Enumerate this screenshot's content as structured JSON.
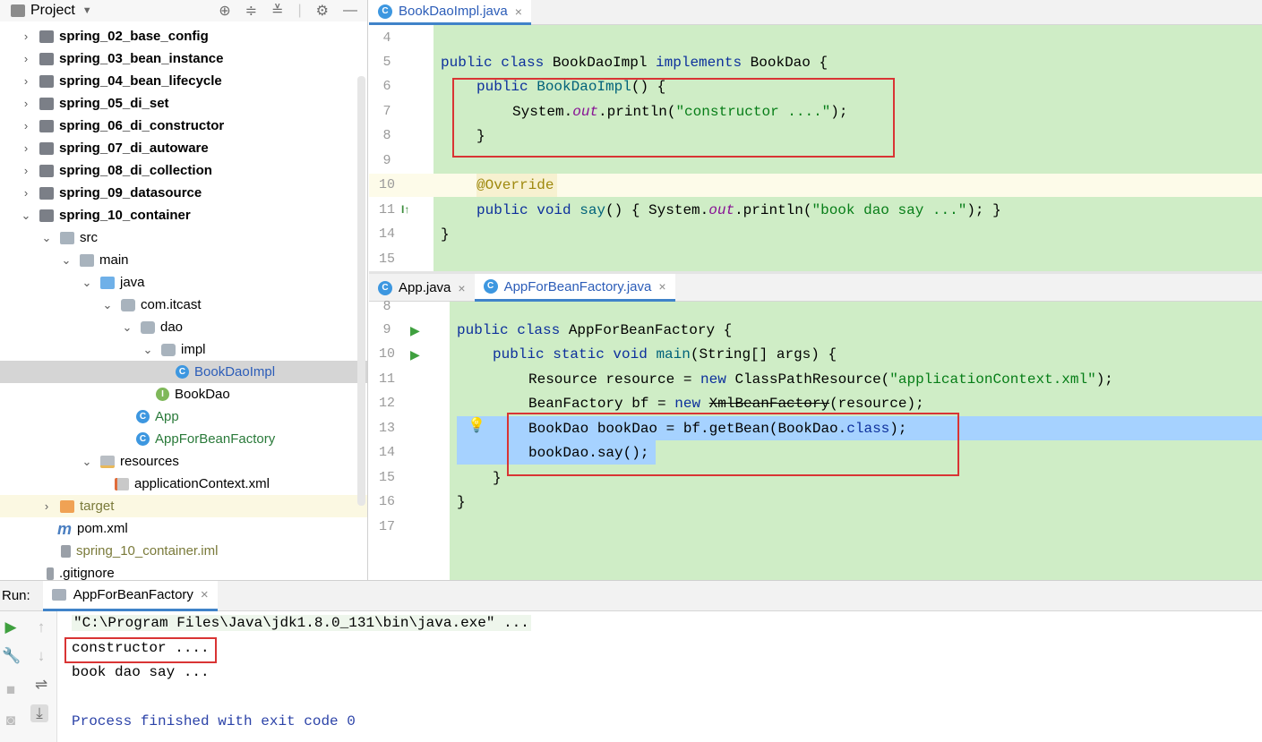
{
  "project_panel": {
    "title": "Project",
    "tree": [
      {
        "label": "spring_02_base_config",
        "expanded": false
      },
      {
        "label": "spring_03_bean_instance",
        "expanded": false
      },
      {
        "label": "spring_04_bean_lifecycle",
        "expanded": false
      },
      {
        "label": "spring_05_di_set",
        "expanded": false
      },
      {
        "label": "spring_06_di_constructor",
        "expanded": false
      },
      {
        "label": "spring_07_di_autoware",
        "expanded": false
      },
      {
        "label": "spring_08_di_collection",
        "expanded": false
      },
      {
        "label": "spring_09_datasource",
        "expanded": false
      },
      {
        "label": "spring_10_container",
        "expanded": true
      },
      {
        "label": "src"
      },
      {
        "label": "main"
      },
      {
        "label": "java"
      },
      {
        "label": "com.itcast"
      },
      {
        "label": "dao"
      },
      {
        "label": "impl"
      },
      {
        "label": "BookDaoImpl",
        "selected": true
      },
      {
        "label": "BookDao"
      },
      {
        "label": "App"
      },
      {
        "label": "AppForBeanFactory"
      },
      {
        "label": "resources"
      },
      {
        "label": "applicationContext.xml"
      },
      {
        "label": "target"
      },
      {
        "label": "pom.xml"
      },
      {
        "label": "spring_10_container.iml"
      },
      {
        "label": ".gitignore"
      }
    ]
  },
  "editor_top": {
    "tab": "BookDaoImpl.java",
    "line_numbers": [
      "4",
      "5",
      "6",
      "7",
      "8",
      "9",
      "10",
      "11",
      "14",
      "15"
    ],
    "lines": {
      "l5": [
        "public class ",
        "BookDaoImpl ",
        "implements ",
        "BookDao {"
      ],
      "l6": [
        "public ",
        "BookDaoImpl",
        "() {"
      ],
      "l7": [
        "System.",
        "out",
        ".println(",
        "\"constructor ....\"",
        ");"
      ],
      "l8": "}",
      "l10": "@Override",
      "l11": [
        "public void ",
        "say",
        "() { System.",
        "out",
        ".println(",
        "\"book dao say ...\"",
        "); }"
      ],
      "l14": "}"
    }
  },
  "editor_bottom": {
    "tabs": [
      "App.java",
      "AppForBeanFactory.java"
    ],
    "active_tab": "AppForBeanFactory.java",
    "line_numbers": [
      "8",
      "9",
      "10",
      "11",
      "12",
      "13",
      "14",
      "15",
      "16",
      "17"
    ],
    "lines": {
      "l9": [
        "public class ",
        "AppForBeanFactory {"
      ],
      "l10": [
        "public static void ",
        "main",
        "(String[] args) {"
      ],
      "l11": [
        "Resource resource = ",
        "new ",
        "ClassPathResource(",
        "\"applicationContext.xml\"",
        ");"
      ],
      "l12": [
        "BeanFactory bf = ",
        "new ",
        "XmlBeanFactory",
        "(resource);"
      ],
      "l13": [
        "BookDao bookDao = bf.getBean(BookDao.",
        "class",
        ");"
      ],
      "l14": "bookDao.say();",
      "l15": "}",
      "l16": "}"
    }
  },
  "run_panel": {
    "label": "Run:",
    "tab": "AppForBeanFactory",
    "output": [
      "\"C:\\Program Files\\Java\\jdk1.8.0_131\\bin\\java.exe\" ...",
      "constructor ....",
      "book dao say ...",
      "",
      "Process finished with exit code 0"
    ]
  },
  "colors": {
    "code_bg": "#cfedc6",
    "selection": "#a6d2ff",
    "annotation_box": "#d93434",
    "keyword": "#0c2f9c"
  }
}
